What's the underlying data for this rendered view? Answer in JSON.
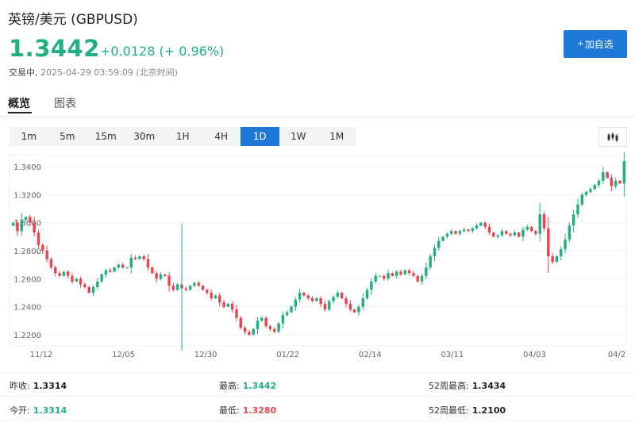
{
  "header": {
    "title": "英镑/美元  (GBPUSD)",
    "price": "1.3442",
    "change": "+0.0128 (+ 0.96%)",
    "status_label": "交易中,",
    "timestamp": "2025-04-29 03:59:09 (北京时间)",
    "add_button": "加自选"
  },
  "tabs": [
    {
      "label": "概览",
      "active": true
    },
    {
      "label": "图表",
      "active": false
    }
  ],
  "periods": [
    {
      "label": "1m",
      "active": false
    },
    {
      "label": "5m",
      "active": false
    },
    {
      "label": "15m",
      "active": false
    },
    {
      "label": "30m",
      "active": false
    },
    {
      "label": "1H",
      "active": false
    },
    {
      "label": "4H",
      "active": false
    },
    {
      "label": "1D",
      "active": true
    },
    {
      "label": "1W",
      "active": false
    },
    {
      "label": "1M",
      "active": false
    }
  ],
  "stats": {
    "prev_close_label": "昨收:",
    "prev_close": "1.3314",
    "open_label": "今开:",
    "open": "1.3314",
    "high_label": "最高:",
    "high": "1.3442",
    "low_label": "最低:",
    "low": "1.3280",
    "w52_high_label": "52周最高:",
    "w52_high": "1.3434",
    "w52_low_label": "52周最低:",
    "w52_low": "1.2100"
  },
  "colors": {
    "up": "#21b080",
    "down": "#e8464f",
    "accent": "#1e7ad6"
  },
  "chart_data": {
    "type": "candlestick",
    "title": "",
    "y_ticks": [
      "1.3400",
      "1.3200",
      "1.3000",
      "1.2800",
      "1.2600",
      "1.2400",
      "1.2200"
    ],
    "x_ticks": [
      "11/12",
      "12/05",
      "12/30",
      "01/22",
      "02/14",
      "03/11",
      "04/03",
      "04/2"
    ],
    "ylim": [
      1.212,
      1.348
    ],
    "grid": "horizontal",
    "crosshair_index": 40,
    "closes": [
      1.3,
      1.294,
      1.302,
      1.304,
      1.3,
      1.293,
      1.284,
      1.28,
      1.274,
      1.268,
      1.264,
      1.262,
      1.265,
      1.262,
      1.258,
      1.26,
      1.256,
      1.254,
      1.25,
      1.254,
      1.258,
      1.263,
      1.266,
      1.265,
      1.268,
      1.27,
      1.268,
      1.268,
      1.275,
      1.274,
      1.276,
      1.274,
      1.268,
      1.264,
      1.26,
      1.263,
      1.262,
      1.255,
      1.252,
      1.256,
      1.253,
      1.252,
      1.255,
      1.257,
      1.255,
      1.252,
      1.25,
      1.246,
      1.248,
      1.243,
      1.24,
      1.242,
      1.238,
      1.232,
      1.225,
      1.222,
      1.22,
      1.224,
      1.23,
      1.232,
      1.226,
      1.224,
      1.222,
      1.228,
      1.234,
      1.236,
      1.24,
      1.245,
      1.25,
      1.248,
      1.246,
      1.244,
      1.246,
      1.242,
      1.238,
      1.244,
      1.247,
      1.25,
      1.246,
      1.242,
      1.238,
      1.236,
      1.24,
      1.246,
      1.252,
      1.258,
      1.262,
      1.262,
      1.26,
      1.264,
      1.262,
      1.265,
      1.263,
      1.266,
      1.264,
      1.262,
      1.258,
      1.262,
      1.268,
      1.276,
      1.282,
      1.287,
      1.29,
      1.292,
      1.294,
      1.292,
      1.294,
      1.295,
      1.294,
      1.296,
      1.298,
      1.3,
      1.297,
      1.293,
      1.29,
      1.291,
      1.294,
      1.292,
      1.291,
      1.293,
      1.29,
      1.295,
      1.297,
      1.294,
      1.292,
      1.306,
      1.296,
      1.276,
      1.272,
      1.276,
      1.281,
      1.288,
      1.298,
      1.306,
      1.313,
      1.32,
      1.322,
      1.324,
      1.327,
      1.33,
      1.336,
      1.332,
      1.326,
      1.33,
      1.328,
      1.344
    ]
  }
}
